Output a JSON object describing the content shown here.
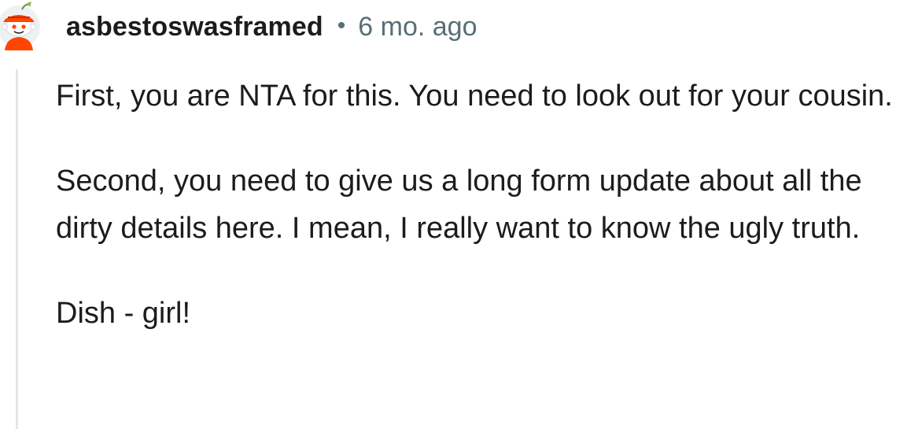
{
  "comment": {
    "author": "asbestoswasframed",
    "separator": "•",
    "timestamp": "6 mo. ago",
    "paragraphs": [
      "First, you are NTA for this. You need to look out for your cousin.",
      "Second, you need to give us a long form update about all the dirty details here. I mean, I really want to know the ugly truth.",
      "Dish - girl!"
    ]
  },
  "colors": {
    "text": "#1c1c1c",
    "meta": "#576f76",
    "thread_line": "#e3e6e8",
    "avatar_accent": "#ff4500"
  },
  "icons": {
    "avatar": "snoo-avatar-icon"
  }
}
